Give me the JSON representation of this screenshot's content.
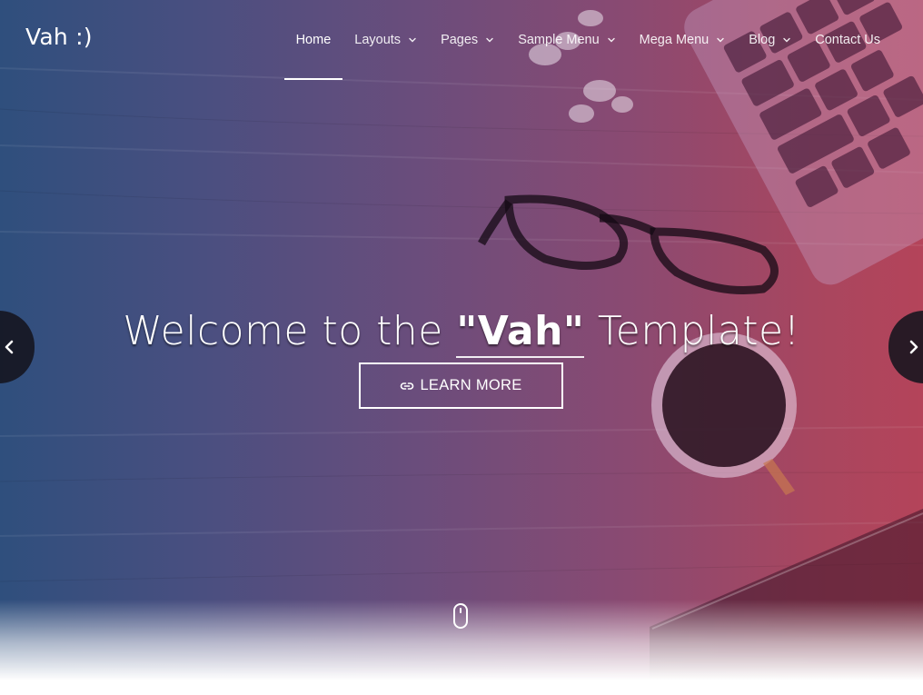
{
  "brand": {
    "logo_text": "Vah :)"
  },
  "nav": {
    "items": [
      {
        "label": "Home",
        "active": true,
        "dropdown": false
      },
      {
        "label": "Layouts",
        "active": false,
        "dropdown": true
      },
      {
        "label": "Pages",
        "active": false,
        "dropdown": true
      },
      {
        "label": "Sample Menu",
        "active": false,
        "dropdown": true
      },
      {
        "label": "Mega Menu",
        "active": false,
        "dropdown": true
      },
      {
        "label": "Blog",
        "active": false,
        "dropdown": true
      },
      {
        "label": "Contact Us",
        "active": false,
        "dropdown": false
      }
    ]
  },
  "hero": {
    "headline_prefix": "Welcome to the ",
    "headline_highlight": "\"Vah\"",
    "headline_suffix": " Template!",
    "cta_label": "LEARN MORE",
    "cta_icon": "link-icon",
    "prev_icon": "chevron-left-icon",
    "next_icon": "chevron-right-icon",
    "scroll_icon": "mouse-scroll-icon"
  },
  "colors": {
    "gradient_left": "#2f4f7d",
    "gradient_mid": "#6a4d7c",
    "gradient_right": "#b4445a",
    "text": "#ffffff",
    "arrow_bg": "#14141e"
  }
}
